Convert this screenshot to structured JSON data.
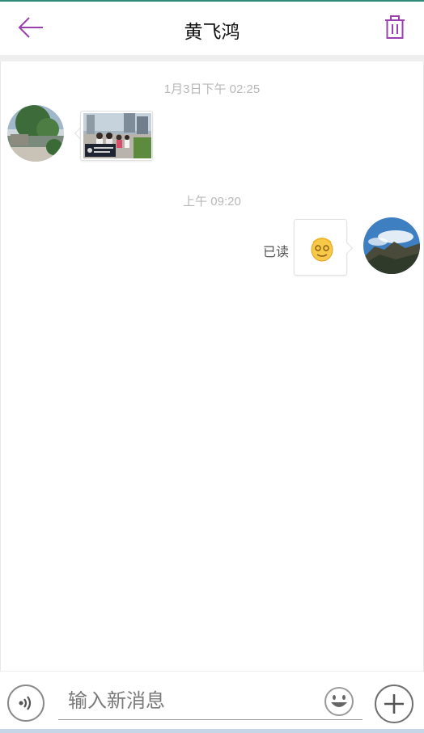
{
  "header": {
    "title": "黄飞鸿",
    "accent_color": "#9a3fb0"
  },
  "messages": [
    {
      "timestamp": "1月3日下午 02:25",
      "side": "left",
      "type": "image",
      "avatar": "landscape-photo-avatar",
      "content_icon": "group-photo-thumbnail"
    },
    {
      "timestamp": "上午 09:20",
      "side": "right",
      "type": "emoji",
      "avatar": "mountain-sky-avatar",
      "content_icon": "smiley-emoji",
      "status": "已读"
    }
  ],
  "input_bar": {
    "placeholder": "输入新消息"
  }
}
